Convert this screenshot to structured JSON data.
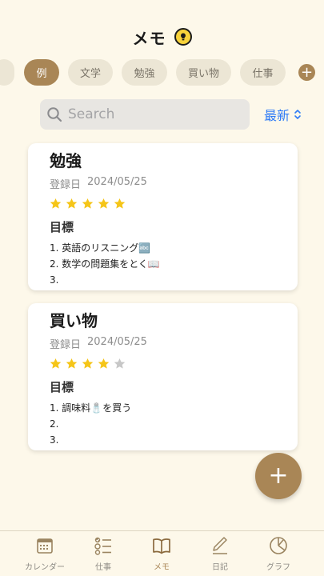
{
  "header": {
    "title": "メモ"
  },
  "categories": {
    "items": [
      {
        "label": "例"
      },
      {
        "label": "文学"
      },
      {
        "label": "勉強"
      },
      {
        "label": "買い物"
      },
      {
        "label": "仕事"
      }
    ],
    "active_index": 0,
    "add_label": "+"
  },
  "search": {
    "placeholder": "Search",
    "value": ""
  },
  "sort": {
    "label": "最新"
  },
  "memos": [
    {
      "title": "勉強",
      "date_label": "登録日",
      "date": "2024/05/25",
      "rating": 5,
      "rating_max": 5,
      "goal_label": "目標",
      "goals": [
        "1. 英語のリスニング🔤",
        "2. 数学の問題集をとく📖",
        "3."
      ]
    },
    {
      "title": "買い物",
      "date_label": "登録日",
      "date": "2024/05/25",
      "rating": 4,
      "rating_max": 5,
      "goal_label": "目標",
      "goals": [
        "1. 調味料🧂を買う",
        "2.",
        "3."
      ]
    }
  ],
  "fab": {
    "label": "+"
  },
  "tabbar": {
    "items": [
      {
        "label": "カレンダー",
        "icon": "calendar-icon"
      },
      {
        "label": "仕事",
        "icon": "checklist-icon"
      },
      {
        "label": "メモ",
        "icon": "book-icon"
      },
      {
        "label": "日記",
        "icon": "pencil-icon"
      },
      {
        "label": "グラフ",
        "icon": "pie-chart-icon"
      }
    ],
    "active_index": 2
  },
  "colors": {
    "background": "#fdf8ea",
    "accent": "#a98656",
    "chip": "#ece6d5",
    "star_on": "#f5c518",
    "star_off": "#c7c7c7",
    "link": "#2f7bf6"
  }
}
